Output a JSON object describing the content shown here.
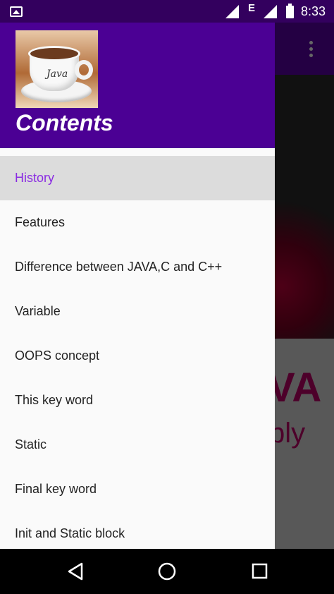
{
  "status_bar": {
    "time": "8:33",
    "network_type": "E",
    "icons": [
      "gallery-icon",
      "signal-icon",
      "signal-icon",
      "battery-icon"
    ]
  },
  "drawer": {
    "title": "Contents",
    "logo_text": "Java",
    "items": [
      {
        "label": "History",
        "active": true
      },
      {
        "label": "Features"
      },
      {
        "label": "Difference between JAVA,C and C++"
      },
      {
        "label": "Variable"
      },
      {
        "label": "OOPS concept"
      },
      {
        "label": "This key word"
      },
      {
        "label": "Static"
      },
      {
        "label": "Final key word"
      },
      {
        "label": "Init and Static block"
      }
    ]
  },
  "background_app": {
    "text_1": "VA",
    "text_2": "ply",
    "icons": [
      "overflow-menu-icon"
    ]
  },
  "nav_bar": {
    "icons": [
      "back-icon",
      "home-icon",
      "recents-icon"
    ]
  },
  "colors": {
    "status_bar": "#33005e",
    "drawer_header": "#4b0094",
    "active_item_text": "#8a2be2",
    "active_item_bg": "#dcdcdc"
  }
}
